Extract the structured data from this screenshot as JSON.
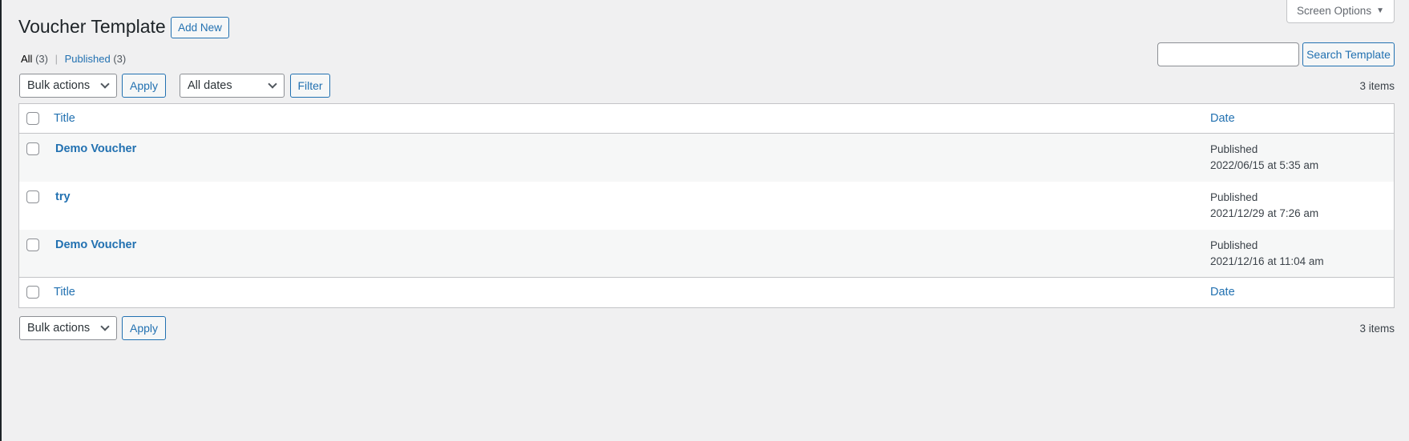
{
  "page": {
    "title": "Voucher Template",
    "add_new": "Add New",
    "screen_options": "Screen Options"
  },
  "views": {
    "all_label": "All",
    "all_count": "(3)",
    "sep": "|",
    "published_label": "Published",
    "published_count": "(3)"
  },
  "search": {
    "value": "",
    "placeholder": "",
    "button": "Search Template"
  },
  "top_nav": {
    "bulk_actions": "Bulk actions",
    "apply": "Apply",
    "dates": "All dates",
    "filter": "Filter",
    "count": "3 items"
  },
  "bottom_nav": {
    "bulk_actions": "Bulk actions",
    "apply": "Apply",
    "count": "3 items"
  },
  "table": {
    "columns": {
      "title": "Title",
      "date": "Date"
    },
    "rows": [
      {
        "title": "Demo Voucher",
        "status": "Published",
        "date": "2022/06/15 at 5:35 am"
      },
      {
        "title": "try",
        "status": "Published",
        "date": "2021/12/29 at 7:26 am"
      },
      {
        "title": "Demo Voucher",
        "status": "Published",
        "date": "2021/12/16 at 11:04 am"
      }
    ]
  },
  "colors": {
    "accent": "#2271b1",
    "background": "#f0f0f1",
    "text": "#3c434a"
  }
}
